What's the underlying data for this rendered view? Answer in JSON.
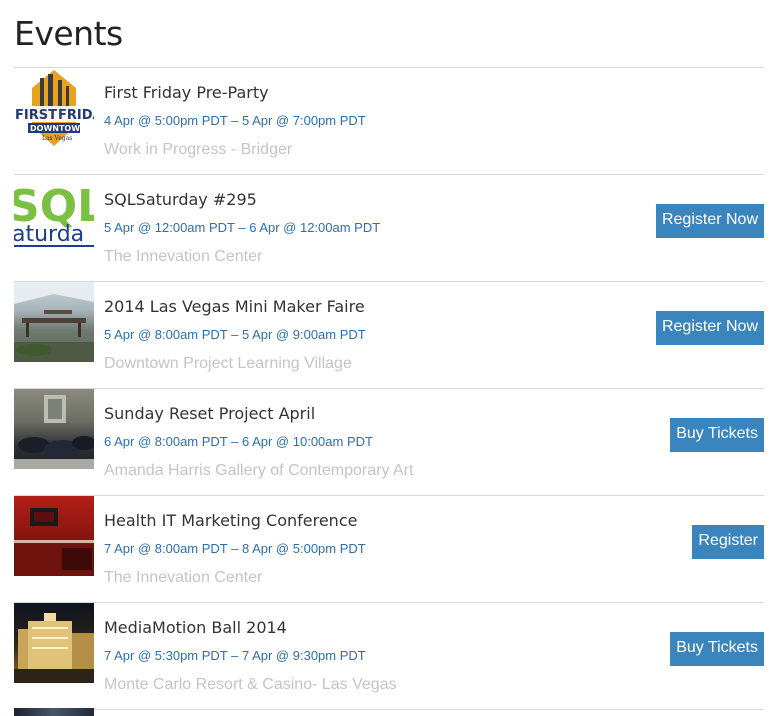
{
  "page": {
    "title": "Events"
  },
  "events": [
    {
      "name": "First Friday Pre-Party",
      "date": "4 Apr @ 5:00pm PDT – 5 Apr @ 7:00pm PDT",
      "venue": "Work in Progress - Bridger",
      "button": "",
      "thumb_text": [
        "FIRST",
        "FRIDA",
        "DOWNTOWN",
        "Las Vegas"
      ]
    },
    {
      "name": "SQLSaturday #295",
      "date": "5 Apr @ 12:00am PDT – 6 Apr @ 12:00am PDT",
      "venue": "The Innevation Center",
      "button": "Register Now",
      "thumb_text": [
        "SQL",
        "aturda"
      ]
    },
    {
      "name": "2014 Las Vegas Mini Maker Faire",
      "date": "5 Apr @ 8:00am PDT – 5 Apr @ 9:00am PDT",
      "venue": "Downtown Project Learning Village",
      "button": "Register Now"
    },
    {
      "name": "Sunday Reset Project April",
      "date": "6 Apr @ 8:00am PDT – 6 Apr @ 10:00am PDT",
      "venue": "Amanda Harris Gallery of Contemporary Art",
      "button": "Buy Tickets"
    },
    {
      "name": "Health IT Marketing Conference",
      "date": "7 Apr @ 8:00am PDT – 8 Apr @ 5:00pm PDT",
      "venue": "The Innevation Center",
      "button": "Register"
    },
    {
      "name": "MediaMotion Ball 2014",
      "date": "7 Apr @ 5:30pm PDT – 7 Apr @ 9:30pm PDT",
      "venue": "Monte Carlo Resort & Casino- Las Vegas",
      "button": "Buy Tickets"
    }
  ],
  "colors": {
    "button_bg": "#3a85bd",
    "date_text": "#2c6fae",
    "venue_text": "#c4c4c4",
    "divider": "#d9d9d9"
  }
}
